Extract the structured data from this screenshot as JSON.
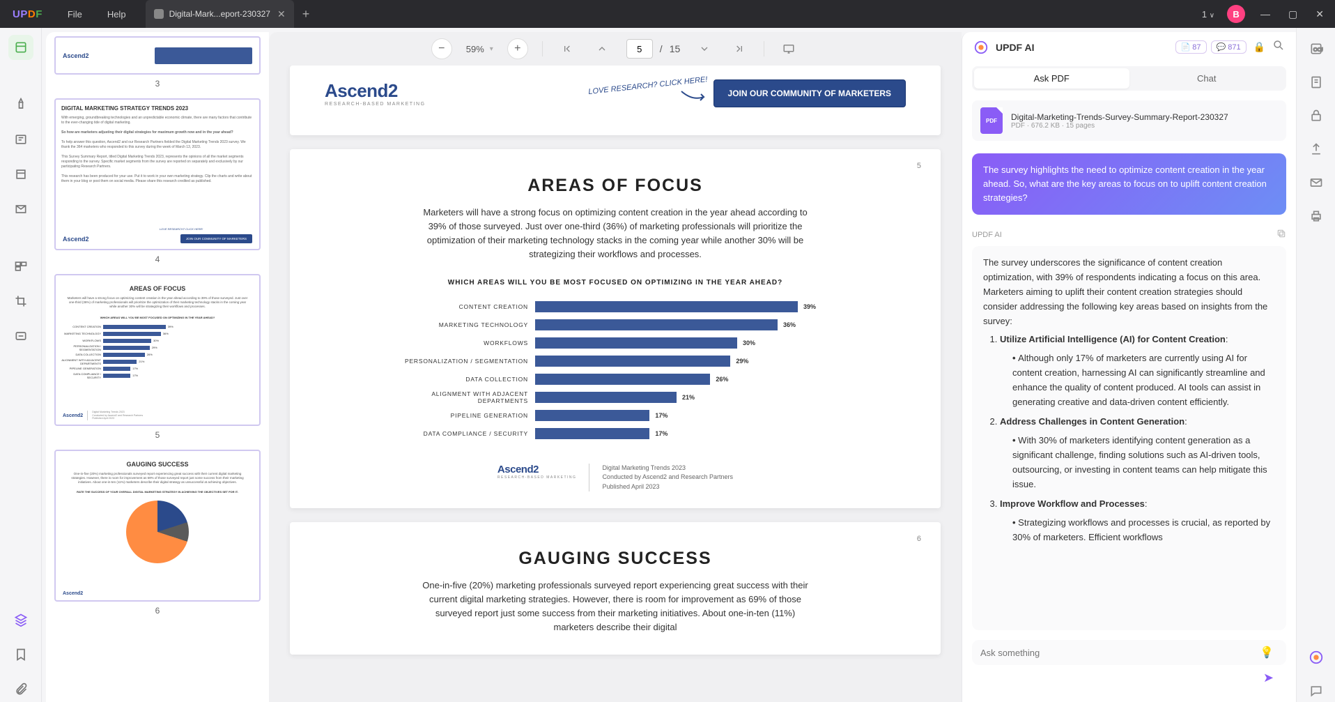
{
  "app": {
    "logo": "UPDF",
    "menu_file": "File",
    "menu_help": "Help",
    "tab_title": "Digital-Mark...eport-230327",
    "doc_num": "1",
    "avatar": "B"
  },
  "toolbar": {
    "zoom": "59%",
    "page_cur": "5",
    "page_sep": "/",
    "page_total": "15"
  },
  "thumbs": {
    "n3": "3",
    "n4": "4",
    "n5": "5",
    "n6": "6"
  },
  "thumb4": {
    "title": "DIGITAL MARKETING STRATEGY TRENDS 2023",
    "btn": "JOIN OUR COMMUNITY OF MARKETERS"
  },
  "thumb5": {
    "title": "AREAS OF FOCUS"
  },
  "thumb6": {
    "title": "GAUGING SUCCESS"
  },
  "page4": {
    "cta_note": "LOVE RESEARCH? CLICK HERE!",
    "cta": "JOIN OUR COMMUNITY OF MARKETERS",
    "ascend": "Ascend2",
    "ascend_sub": "RESEARCH-BASED MARKETING"
  },
  "page5": {
    "num": "5",
    "title": "AREAS OF FOCUS",
    "body": "Marketers will have a strong focus on optimizing content creation in the year ahead according to 39% of those surveyed. Just over one-third (36%) of marketing professionals will prioritize the optimization of their marketing technology stacks in the coming year while another 30% will be strategizing their workflows and processes.",
    "chart_title": "WHICH AREAS WILL YOU BE MOST FOCUSED ON OPTIMIZING IN THE YEAR AHEAD?",
    "ftr1": "Digital Marketing Trends 2023",
    "ftr2": "Conducted by Ascend2 and Research Partners",
    "ftr3": "Published April 2023"
  },
  "page6": {
    "num": "6",
    "title": "GAUGING SUCCESS",
    "body": "One-in-five (20%) marketing professionals surveyed report experiencing great success with their current digital marketing strategies. However, there is room for improvement as 69% of those surveyed report just some success from their marketing initiatives. About one-in-ten (11%) marketers describe their digital"
  },
  "chart_data": {
    "type": "bar",
    "title": "WHICH AREAS WILL YOU BE MOST FOCUSED ON OPTIMIZING IN THE YEAR AHEAD?",
    "categories": [
      "CONTENT CREATION",
      "MARKETING TECHNOLOGY",
      "WORKFLOWS",
      "PERSONALIZATION / SEGMENTATION",
      "DATA COLLECTION",
      "ALIGNMENT WITH ADJACENT DEPARTMENTS",
      "PIPELINE GENERATION",
      "DATA COMPLIANCE / SECURITY"
    ],
    "values": [
      39,
      36,
      30,
      29,
      26,
      21,
      17,
      17
    ],
    "value_labels": [
      "39%",
      "36%",
      "30%",
      "29%",
      "26%",
      "21%",
      "17%",
      "17%"
    ],
    "xlabel": "",
    "ylabel": "",
    "xlim": [
      0,
      45
    ]
  },
  "ai": {
    "title": "UPDF AI",
    "badge1": "87",
    "badge2": "871",
    "tab_ask": "Ask PDF",
    "tab_chat": "Chat",
    "doc_name": "Digital-Marketing-Trends-Survey-Summary-Report-230327",
    "doc_meta": "PDF · 676.2 KB · 15 pages",
    "user_msg": "The survey highlights the need to optimize content creation in the year ahead. So, what are the key areas to focus on to uplift content creation strategies?",
    "source": "UPDF AI",
    "resp_intro": "The survey underscores the significance of content creation optimization, with 39% of respondents indicating a focus on this area. Marketers aiming to uplift their content creation strategies should consider addressing the following key areas based on insights from the survey:",
    "li1": "Utilize Artificial Intelligence (AI) for Content Creation",
    "li1_b": "Although only 17% of marketers are currently using AI for content creation, harnessing AI can significantly streamline and enhance the quality of content produced. AI tools can assist in generating creative and data-driven content efficiently.",
    "li2": "Address Challenges in Content Generation",
    "li2_b": "With 30% of marketers identifying content generation as a significant challenge, finding solutions such as AI-driven tools, outsourcing, or investing in content teams can help mitigate this issue.",
    "li3": "Improve Workflow and Processes",
    "li3_b": "Strategizing workflows and processes is crucial, as reported by 30% of marketers. Efficient workflows",
    "placeholder": "Ask something"
  }
}
